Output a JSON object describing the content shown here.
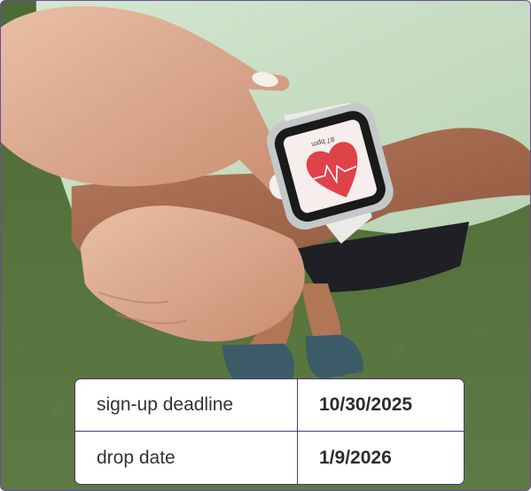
{
  "photo": {
    "subject": "smartwatch-heart-rate-photo",
    "watch_screen_text": "87",
    "watch_screen_unit": "bpm"
  },
  "deadlines": {
    "rows": [
      {
        "label": "sign-up deadline",
        "value": "10/30/2025"
      },
      {
        "label": "drop date",
        "value": "1/9/2026"
      }
    ]
  },
  "colors": {
    "border": "#4a3778",
    "grass": "#556c3d",
    "shirt": "#c4dcc1",
    "heart": "#e0424a"
  }
}
